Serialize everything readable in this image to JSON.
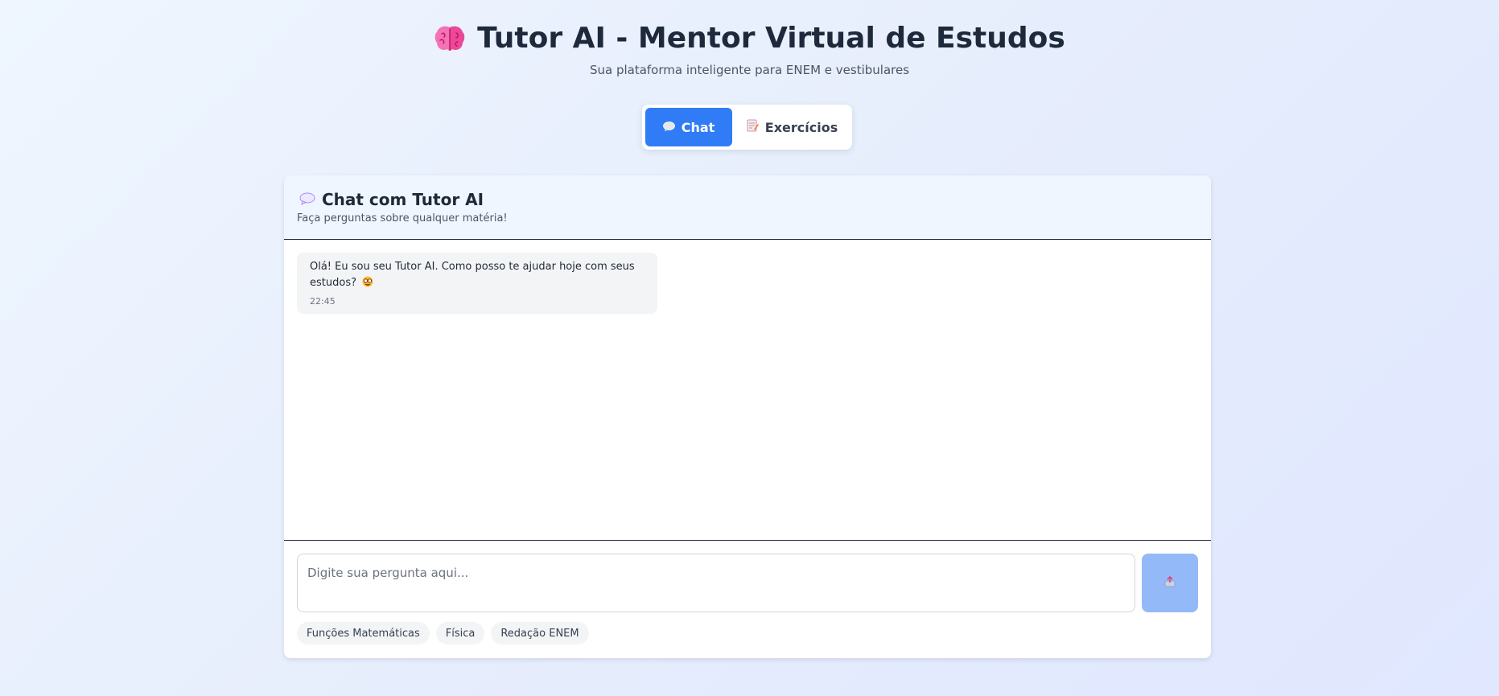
{
  "header": {
    "title": "Tutor AI - Mentor Virtual de Estudos",
    "subtitle": "Sua plataforma inteligente para ENEM e vestibulares",
    "icon": "brain-icon"
  },
  "tabs": [
    {
      "label": "Chat",
      "icon": "speech-bubble-icon",
      "active": true
    },
    {
      "label": "Exercícios",
      "icon": "memo-icon",
      "active": false
    }
  ],
  "chat": {
    "title": "Chat com Tutor AI",
    "title_icon": "speech-bubble-icon",
    "subtitle": "Faça perguntas sobre qualquer matéria!",
    "messages": [
      {
        "text": "Olá! Eu sou seu Tutor AI. Como posso te ajudar hoje com seus estudos?",
        "emoji": "nerd-face-icon",
        "time": "22:45"
      }
    ],
    "input_placeholder": "Digite sua pergunta aqui...",
    "send_icon": "outbox-tray-icon"
  },
  "suggestions": [
    "Funções Matemáticas",
    "Física",
    "Redação ENEM"
  ],
  "colors": {
    "accent": "#2f7cf6",
    "send_button_disabled": "#93b9f8",
    "card_header_bg": "#eff6ff",
    "bubble_bg": "#f3f4f6"
  }
}
